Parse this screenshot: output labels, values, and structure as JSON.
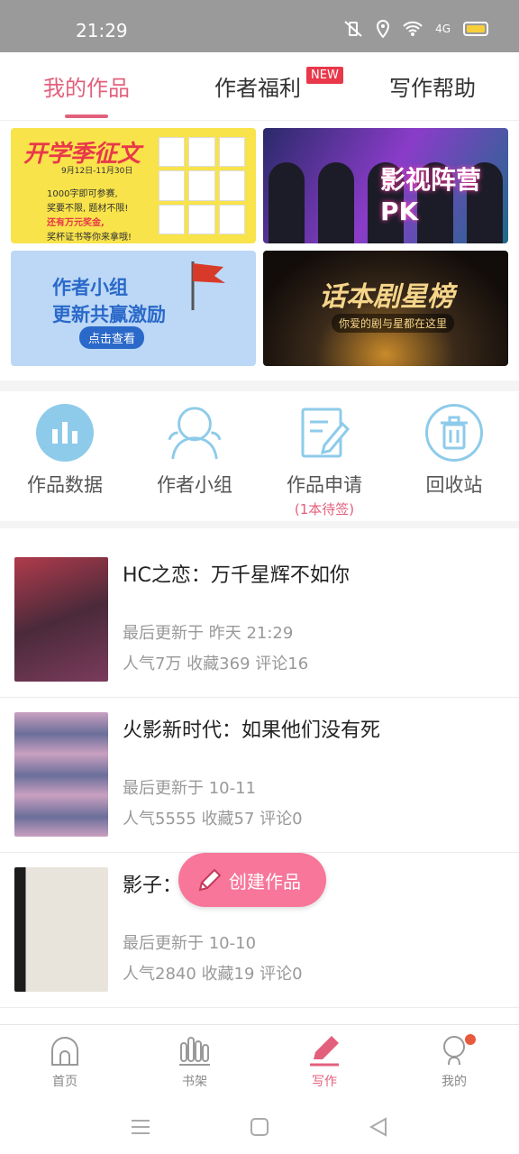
{
  "status_bar": {
    "time": "21:29",
    "network": "4G"
  },
  "tabs": {
    "my_works": "我的作品",
    "author_benefits": "作者福利",
    "new_badge": "NEW",
    "writing_help": "写作帮助"
  },
  "banners": {
    "b1": {
      "title": "开学季征文",
      "dates": "9月12日-11月30日",
      "lines": [
        "1000字即可参赛,",
        "奖要不限, 题材不限!",
        "还有万元奖金,",
        "奖杯证书等你来拿哦!"
      ]
    },
    "b2": {
      "title": "影视阵营PK"
    },
    "b3": {
      "title_line1": "作者小组",
      "title_line2": "更新共赢激励",
      "button": "点击查看"
    },
    "b4": {
      "title": "话本剧星榜",
      "subtitle": "你爱的剧与星都在这里"
    }
  },
  "quick_actions": [
    {
      "label": "作品数据",
      "icon": "bar-chart-icon"
    },
    {
      "label": "作者小组",
      "icon": "group-icon"
    },
    {
      "label": "作品申请",
      "icon": "edit-document-icon",
      "note": "(1本待签)"
    },
    {
      "label": "回收站",
      "icon": "trash-icon"
    }
  ],
  "works": [
    {
      "title": "HC之恋：万千星辉不如你",
      "updated": "最后更新于 昨天 21:29",
      "stats": "人气7万  收藏369  评论16"
    },
    {
      "title": "火影新时代：如果他们没有死",
      "updated": "最后更新于 10-11",
      "stats": "人气5555  收藏57  评论0"
    },
    {
      "title": "影子：",
      "updated": "最后更新于 10-10",
      "stats": "人气2840  收藏19  评论0"
    }
  ],
  "fab": {
    "label": "创建作品"
  },
  "bottom_nav": [
    {
      "label": "首页",
      "icon": "home-icon"
    },
    {
      "label": "书架",
      "icon": "bookshelf-icon"
    },
    {
      "label": "写作",
      "icon": "pen-icon",
      "active": true
    },
    {
      "label": "我的",
      "icon": "profile-icon",
      "badge": true
    }
  ],
  "colors": {
    "accent": "#e2607c",
    "fab": "#f7769a",
    "icon_blue": "#8ecbea",
    "new_badge": "#e8384a"
  }
}
